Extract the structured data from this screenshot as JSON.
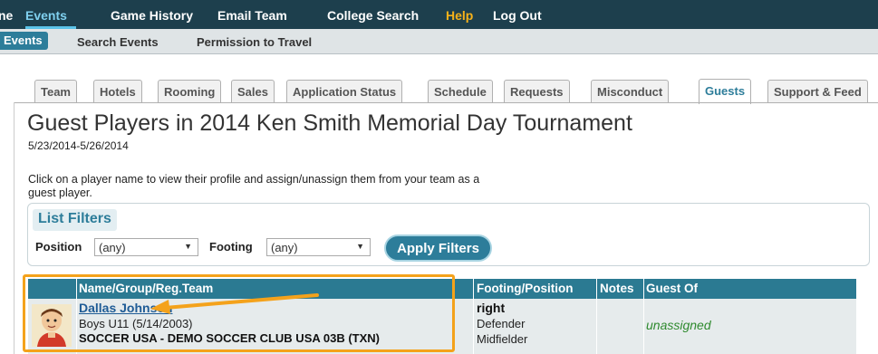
{
  "topnav": {
    "items": [
      "ne",
      "Events",
      "Game History",
      "Email Team",
      "College Search",
      "Help",
      "Log Out"
    ]
  },
  "subnav": {
    "items": [
      "Events",
      "Search Events",
      "Permission to Travel"
    ]
  },
  "tabs": [
    "Team",
    "Hotels",
    "Rooming",
    "Sales",
    "Application Status",
    "Schedule",
    "Requests",
    "Misconduct",
    "Guests",
    "Support & Feed"
  ],
  "page": {
    "title": "Guest Players in 2014 Ken Smith Memorial Day Tournament",
    "dates": "5/23/2014-5/26/2014",
    "instructions": "Click on a player name to view their profile and assign/unassign them from your team as a guest player."
  },
  "filters": {
    "title": "List Filters",
    "position_label": "Position",
    "position_value": "(any)",
    "footing_label": "Footing",
    "footing_value": "(any)",
    "apply_label": "Apply Filters"
  },
  "table": {
    "headers": [
      "Name/Group/Reg.Team",
      "Footing/Position",
      "Notes",
      "Guest Of"
    ],
    "rows": [
      {
        "name": "Dallas Johnson",
        "group": "Boys U11 (5/14/2003)",
        "team": "SOCCER USA - DEMO SOCCER CLUB USA 03B (TXN)",
        "footing": "right",
        "position1": "Defender",
        "position2": "Midfielder",
        "notes": "",
        "guest_of": "unassigned"
      }
    ]
  },
  "colors": {
    "nav_bg": "#1d3f4d",
    "accent": "#2d7d9a",
    "highlight": "#f4a21b",
    "help": "#f6b21a",
    "unassigned": "#2e8a2e"
  }
}
